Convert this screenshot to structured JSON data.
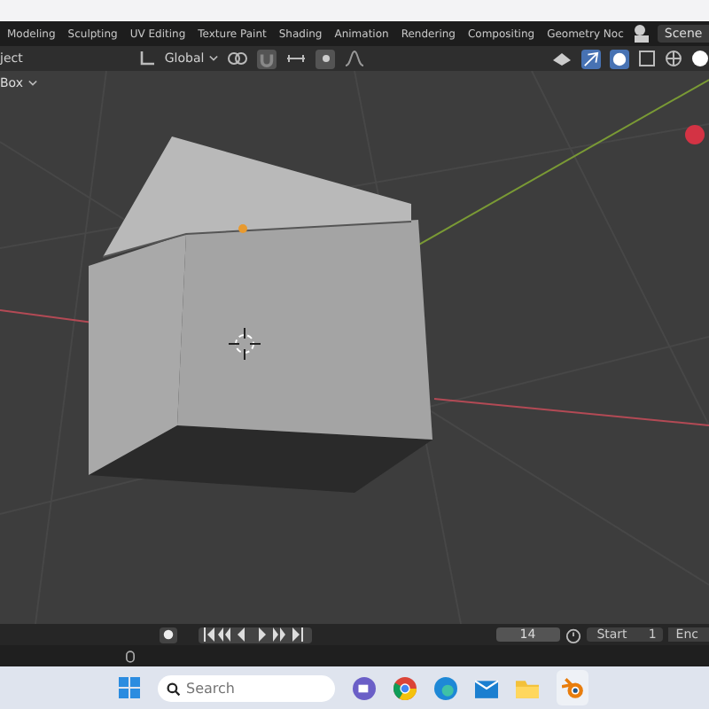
{
  "workspace_tabs": [
    {
      "label": "Modeling",
      "selected": false
    },
    {
      "label": "Sculpting",
      "selected": false
    },
    {
      "label": "UV Editing",
      "selected": false
    },
    {
      "label": "Texture Paint",
      "selected": false
    },
    {
      "label": "Shading",
      "selected": false
    },
    {
      "label": "Animation",
      "selected": false
    },
    {
      "label": "Rendering",
      "selected": false
    },
    {
      "label": "Compositing",
      "selected": false
    },
    {
      "label": "Geometry Noc",
      "selected": false
    }
  ],
  "scene": "Scene",
  "header": {
    "mode": "ject",
    "orientation": "Global",
    "select_box": "Box"
  },
  "timeline": {
    "current_frame": "14",
    "start_label": "Start",
    "start": "1",
    "end_label": "Enc"
  },
  "taskbar": {
    "search_placeholder": "Search"
  }
}
